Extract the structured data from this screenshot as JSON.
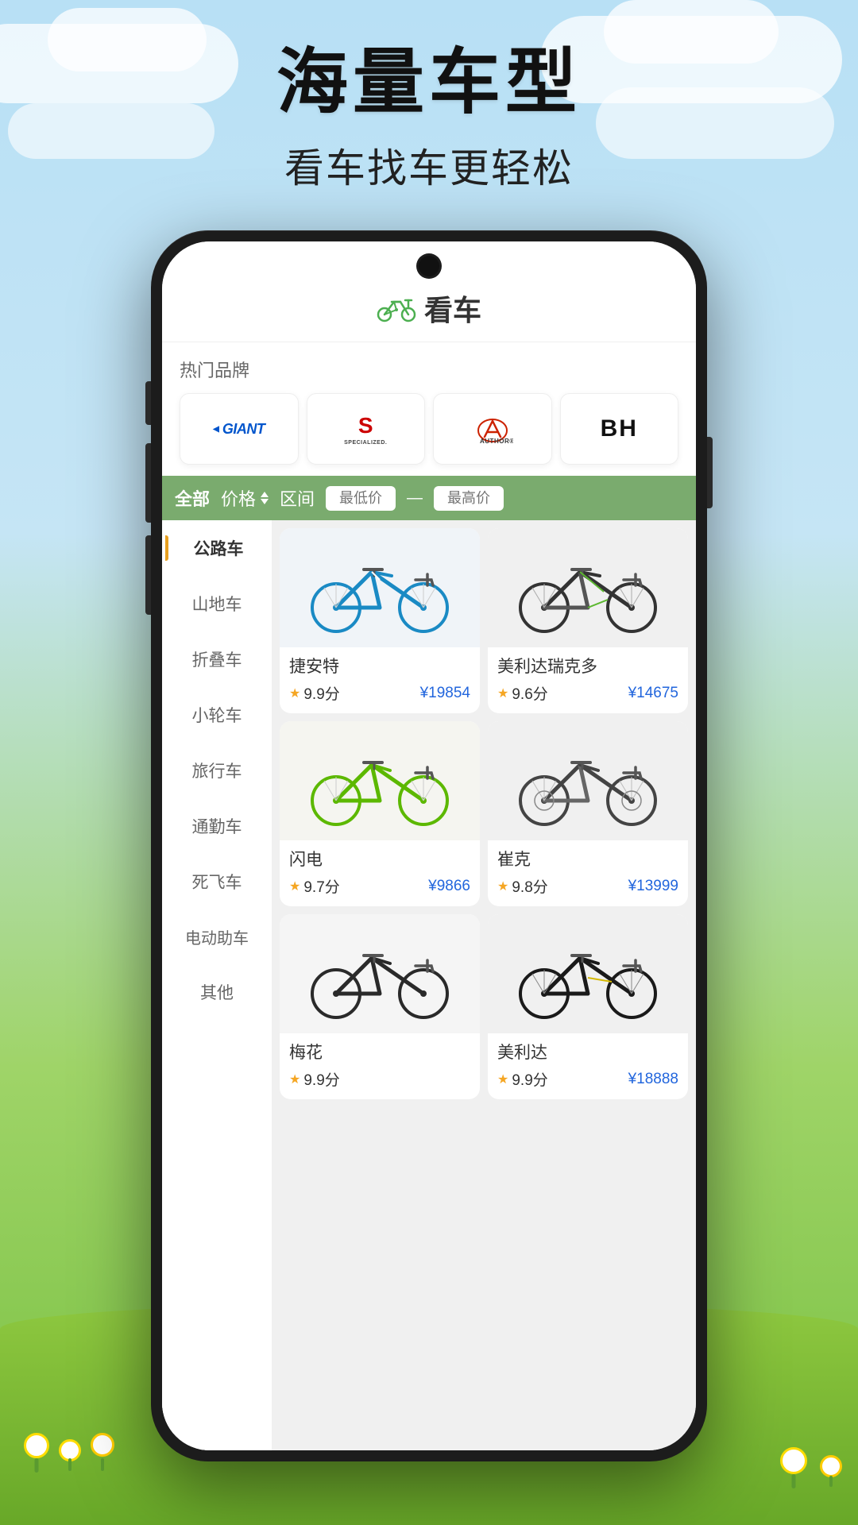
{
  "page": {
    "background": "#b8dff0"
  },
  "header": {
    "title": "海量车型",
    "subtitle": "看车找车更轻松"
  },
  "app": {
    "logo_icon": "🚲",
    "logo_text": "看车"
  },
  "brands": {
    "label": "热门品牌",
    "items": [
      {
        "id": "giant",
        "name": "GIANT"
      },
      {
        "id": "specialized",
        "name": "SPECIALIZED"
      },
      {
        "id": "author",
        "name": "AUTHOR"
      },
      {
        "id": "bh",
        "name": "BH"
      }
    ]
  },
  "filter": {
    "all_label": "全部",
    "price_label": "价格",
    "range_label": "区间",
    "min_placeholder": "最低价",
    "max_placeholder": "最高价"
  },
  "sidebar": {
    "items": [
      {
        "id": "road",
        "label": "公路车",
        "active": true
      },
      {
        "id": "mountain",
        "label": "山地车",
        "active": false
      },
      {
        "id": "folding",
        "label": "折叠车",
        "active": false
      },
      {
        "id": "bmx",
        "label": "小轮车",
        "active": false
      },
      {
        "id": "touring",
        "label": "旅行车",
        "active": false
      },
      {
        "id": "commute",
        "label": "通勤车",
        "active": false
      },
      {
        "id": "fixie",
        "label": "死飞车",
        "active": false
      },
      {
        "id": "ebike",
        "label": "电动助车",
        "active": false
      },
      {
        "id": "other",
        "label": "其他",
        "active": false
      }
    ]
  },
  "products": [
    {
      "id": "1",
      "name": "捷安特",
      "rating": "9.9分",
      "price": "¥19854",
      "color": "blue"
    },
    {
      "id": "2",
      "name": "美利达瑞克多",
      "rating": "9.6分",
      "price": "¥14675",
      "color": "dark"
    },
    {
      "id": "3",
      "name": "闪电",
      "rating": "9.7分",
      "price": "¥9866",
      "color": "green"
    },
    {
      "id": "4",
      "name": "崔克",
      "rating": "9.8分",
      "price": "¥13999",
      "color": "dark2"
    },
    {
      "id": "5",
      "name": "梅花",
      "rating": "9.9分",
      "price": "",
      "color": "dark3"
    },
    {
      "id": "6",
      "name": "美利达",
      "rating": "9.9分",
      "price": "¥18888",
      "color": "dark4"
    }
  ]
}
